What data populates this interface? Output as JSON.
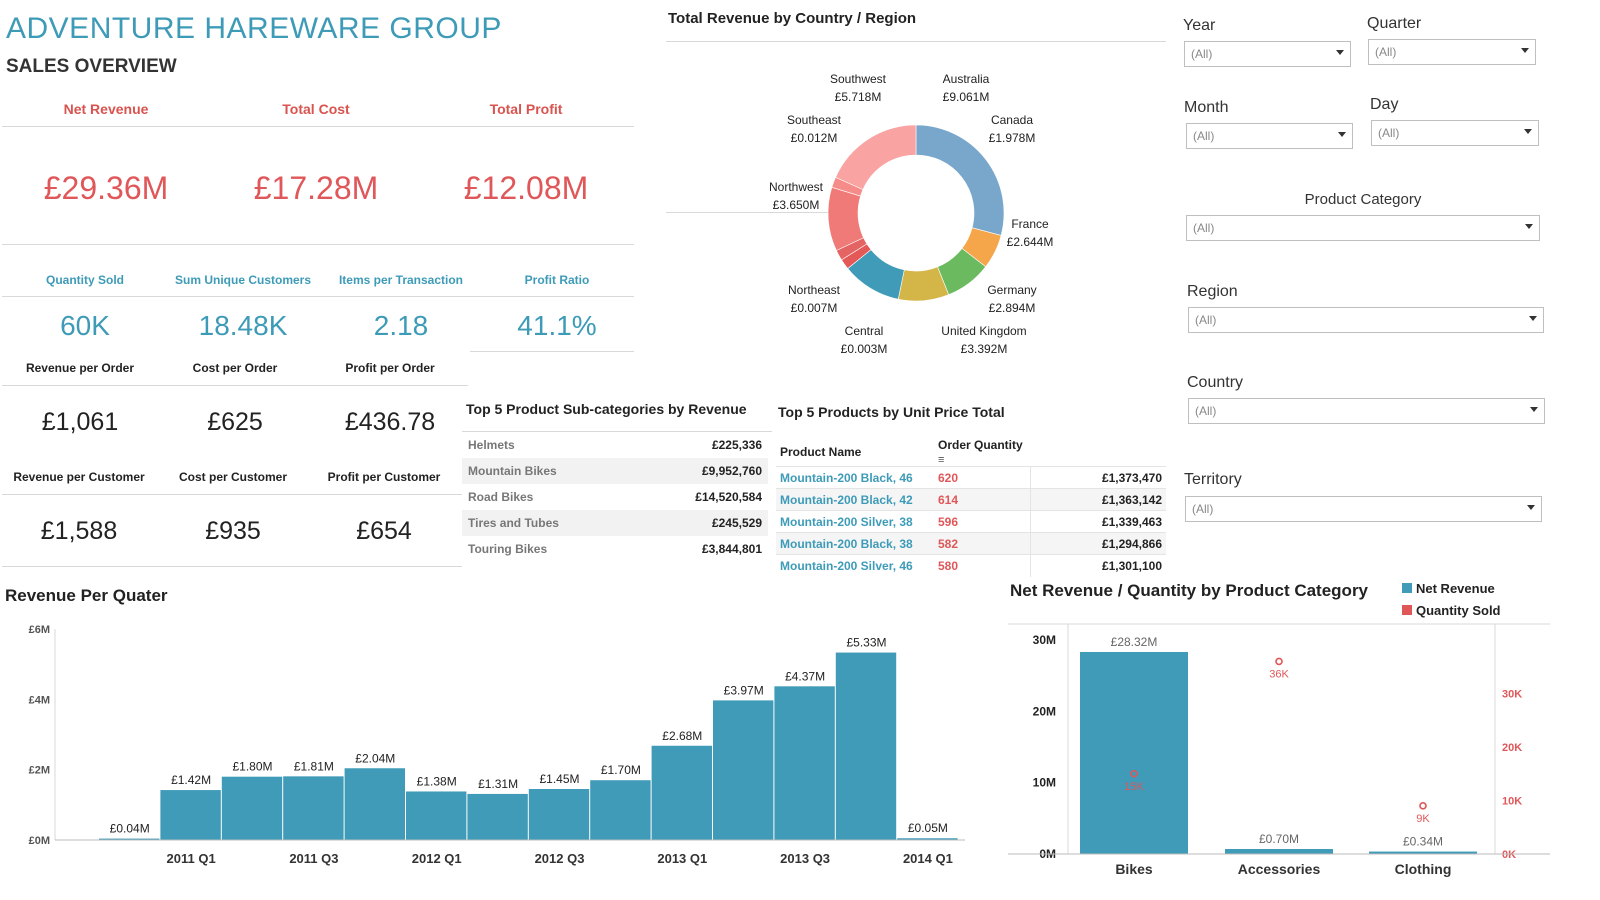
{
  "header": {
    "brand": "ADVENTURE HAREWARE GROUP",
    "subtitle": "SALES OVERVIEW"
  },
  "kpi_top": [
    {
      "label": "Net Revenue",
      "value": "£29.36M"
    },
    {
      "label": "Total Cost",
      "value": "£17.28M"
    },
    {
      "label": "Total Profit",
      "value": "£12.08M"
    }
  ],
  "kpi_mid": [
    {
      "label": "Quantity Sold",
      "value": "60K"
    },
    {
      "label": "Sum Unique Customers",
      "value": "18.48K"
    },
    {
      "label": "Items per Transaction",
      "value": "2.18"
    },
    {
      "label": "Profit Ratio",
      "value": "41.1%"
    }
  ],
  "kpi_order": [
    {
      "label": "Revenue per Order",
      "value": "£1,061"
    },
    {
      "label": "Cost per Order",
      "value": "£625"
    },
    {
      "label": "Profit per Order",
      "value": "£436.78"
    }
  ],
  "kpi_customer": [
    {
      "label": "Revenue per Customer",
      "value": "£1,588"
    },
    {
      "label": "Cost per Customer",
      "value": "£935"
    },
    {
      "label": "Profit per Customer",
      "value": "£654"
    }
  ],
  "donut": {
    "title": "Total Revenue by Country / Region",
    "segments": [
      {
        "name": "Australia",
        "value": "£9.061M",
        "amount": 9.061,
        "color": "#79a7cc"
      },
      {
        "name": "Canada",
        "value": "£1.978M",
        "amount": 1.978,
        "color": "#f5a54a"
      },
      {
        "name": "France",
        "value": "£2.644M",
        "amount": 2.644,
        "color": "#6cba5f"
      },
      {
        "name": "Germany",
        "value": "£2.894M",
        "amount": 2.894,
        "color": "#d4b548"
      },
      {
        "name": "United Kingdom",
        "value": "£3.392M",
        "amount": 3.392,
        "color": "#3f9bb8"
      },
      {
        "name": "Central",
        "value": "£0.003M",
        "amount": 0.003,
        "color": "#e55858"
      },
      {
        "name": "Northeast",
        "value": "£0.007M",
        "amount": 0.007,
        "color": "#e46464"
      },
      {
        "name": "Northwest",
        "value": "£3.650M",
        "amount": 3.65,
        "color": "#ef7a78"
      },
      {
        "name": "Southeast",
        "value": "£0.012M",
        "amount": 0.012,
        "color": "#f58c8a"
      },
      {
        "name": "Southwest",
        "value": "£5.718M",
        "amount": 5.718,
        "color": "#f9a3a2"
      }
    ]
  },
  "subcategories": {
    "title": "Top 5 Product Sub-categories by Revenue",
    "rows": [
      {
        "name": "Helmets",
        "value": "£225,336"
      },
      {
        "name": "Mountain Bikes",
        "value": "£9,952,760"
      },
      {
        "name": "Road Bikes",
        "value": "£14,520,584"
      },
      {
        "name": "Tires and Tubes",
        "value": "£245,529"
      },
      {
        "name": "Touring Bikes",
        "value": "£3,844,801"
      }
    ]
  },
  "products": {
    "title": "Top 5 Products by Unit Price Total",
    "col_name": "Product Name",
    "col_qty": "Order Quantity",
    "rows": [
      {
        "name": "Mountain-200 Black, 46",
        "qty": "620",
        "total": "£1,373,470"
      },
      {
        "name": "Mountain-200 Black, 42",
        "qty": "614",
        "total": "£1,363,142"
      },
      {
        "name": "Mountain-200 Silver, 38",
        "qty": "596",
        "total": "£1,339,463"
      },
      {
        "name": "Mountain-200 Black, 38",
        "qty": "582",
        "total": "£1,294,866"
      },
      {
        "name": "Mountain-200 Silver, 46",
        "qty": "580",
        "total": "£1,301,100"
      }
    ]
  },
  "filters": {
    "year": {
      "label": "Year",
      "value": "(All)"
    },
    "quarter": {
      "label": "Quarter",
      "value": "(All)"
    },
    "month": {
      "label": "Month",
      "value": "(All)"
    },
    "day": {
      "label": "Day",
      "value": "(All)"
    },
    "category": {
      "label": "Product Category",
      "value": "(All)"
    },
    "region": {
      "label": "Region",
      "value": "(All)"
    },
    "country": {
      "label": "Country",
      "value": "(All)"
    },
    "territory": {
      "label": "Territory",
      "value": "(All)"
    }
  },
  "chart_data": [
    {
      "type": "bar",
      "title": "Revenue Per Quater",
      "categories": [
        "2010 Q4",
        "2011 Q1",
        "2011 Q2",
        "2011 Q3",
        "2011 Q4",
        "2012 Q1",
        "2012 Q2",
        "2012 Q3",
        "2012 Q4",
        "2013 Q1",
        "2013 Q2",
        "2013 Q3",
        "2013 Q4",
        "2014 Q1"
      ],
      "tick_labels": [
        "2011 Q1",
        "2011 Q3",
        "2012 Q1",
        "2012 Q3",
        "2013 Q1",
        "2013 Q3",
        "2014 Q1"
      ],
      "values": [
        0.04,
        1.42,
        1.8,
        1.81,
        2.04,
        1.38,
        1.31,
        1.45,
        1.7,
        2.68,
        3.97,
        4.37,
        5.33,
        0.05
      ],
      "labels": [
        "£0.04M",
        "£1.42M",
        "£1.80M",
        "£1.81M",
        "£2.04M",
        "£1.38M",
        "£1.31M",
        "£1.45M",
        "£1.70M",
        "£2.68M",
        "£3.97M",
        "£4.37M",
        "£5.33M",
        "£0.05M"
      ],
      "yticks": [
        "£0M",
        "£2M",
        "£4M",
        "£6M"
      ],
      "ylim": [
        0,
        6
      ],
      "color": "#3f9bb8"
    },
    {
      "type": "bar",
      "title": "Net Revenue / Quantity by Product Category",
      "categories": [
        "Bikes",
        "Accessories",
        "Clothing"
      ],
      "series": [
        {
          "name": "Net Revenue",
          "values": [
            28.32,
            0.7,
            0.34
          ],
          "labels": [
            "£28.32M",
            "£0.70M",
            "£0.34M"
          ],
          "color": "#3f9bb8"
        },
        {
          "name": "Quantity Sold",
          "values": [
            15,
            36,
            9
          ],
          "labels": [
            "15K",
            "36K",
            "9K"
          ],
          "color": "#e05759"
        }
      ],
      "y_left_ticks": [
        "0M",
        "10M",
        "20M",
        "30M"
      ],
      "y_left_lim": [
        0,
        30
      ],
      "y_right_ticks": [
        "0K",
        "10K",
        "20K",
        "30K"
      ],
      "y_right_lim": [
        0,
        40
      ],
      "legend_position": "top-right"
    }
  ]
}
